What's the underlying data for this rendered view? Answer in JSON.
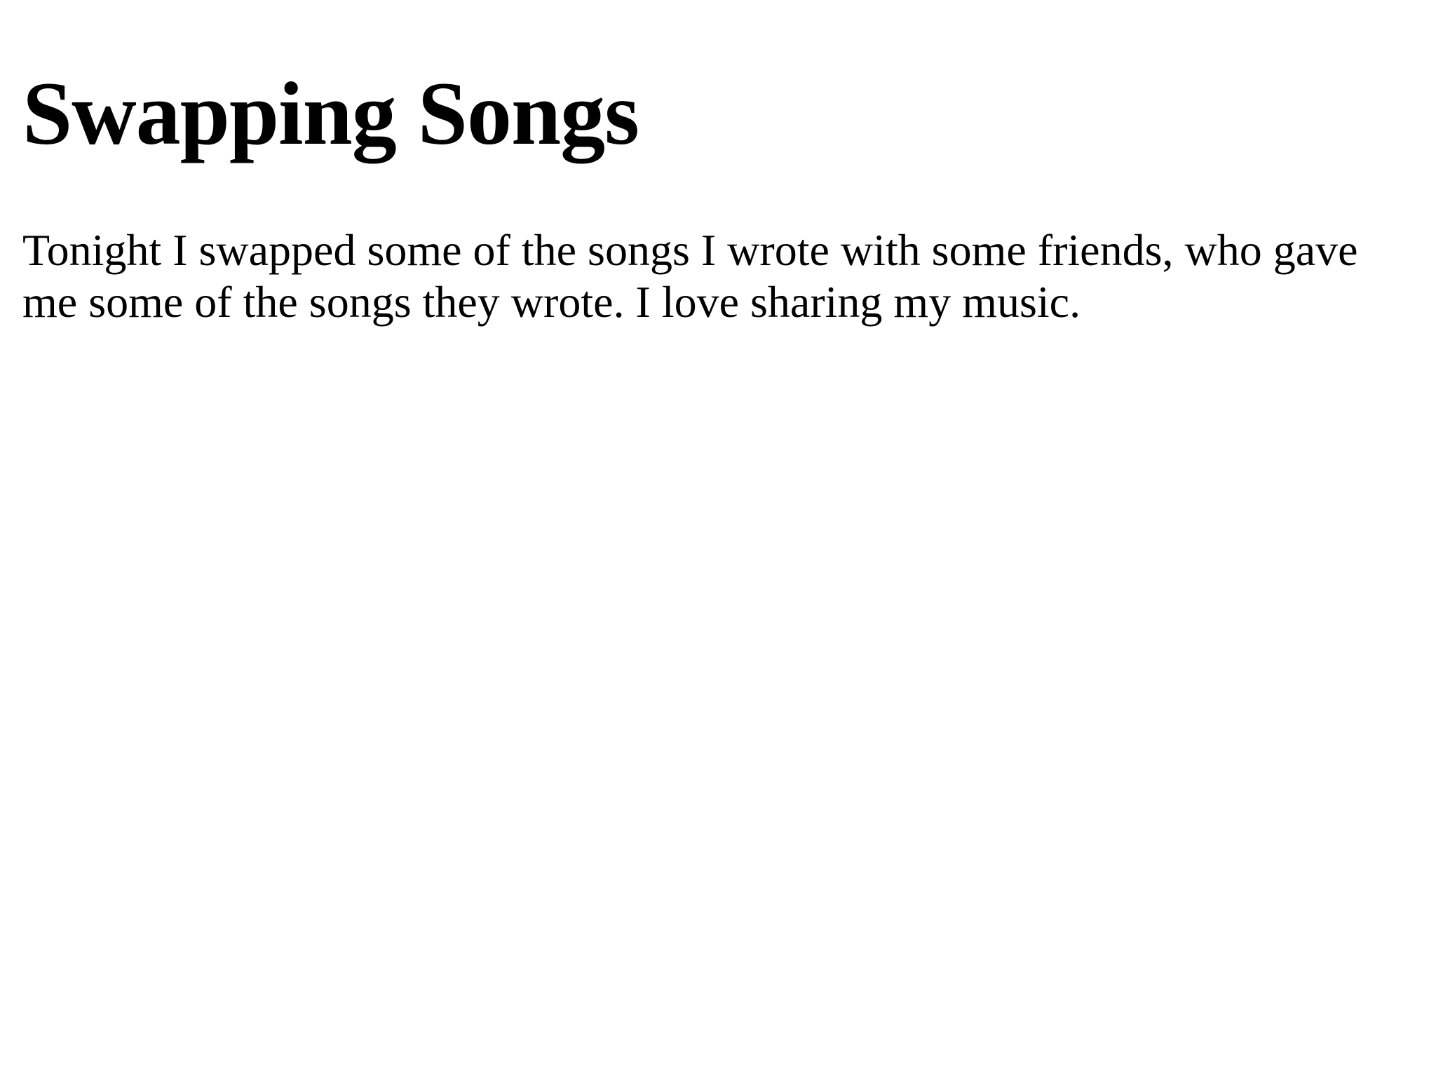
{
  "article": {
    "title": "Swapping Songs",
    "paragraph": "Tonight I swapped some of the songs I wrote with some friends, who gave me some of the songs they wrote. I love sharing my music."
  }
}
